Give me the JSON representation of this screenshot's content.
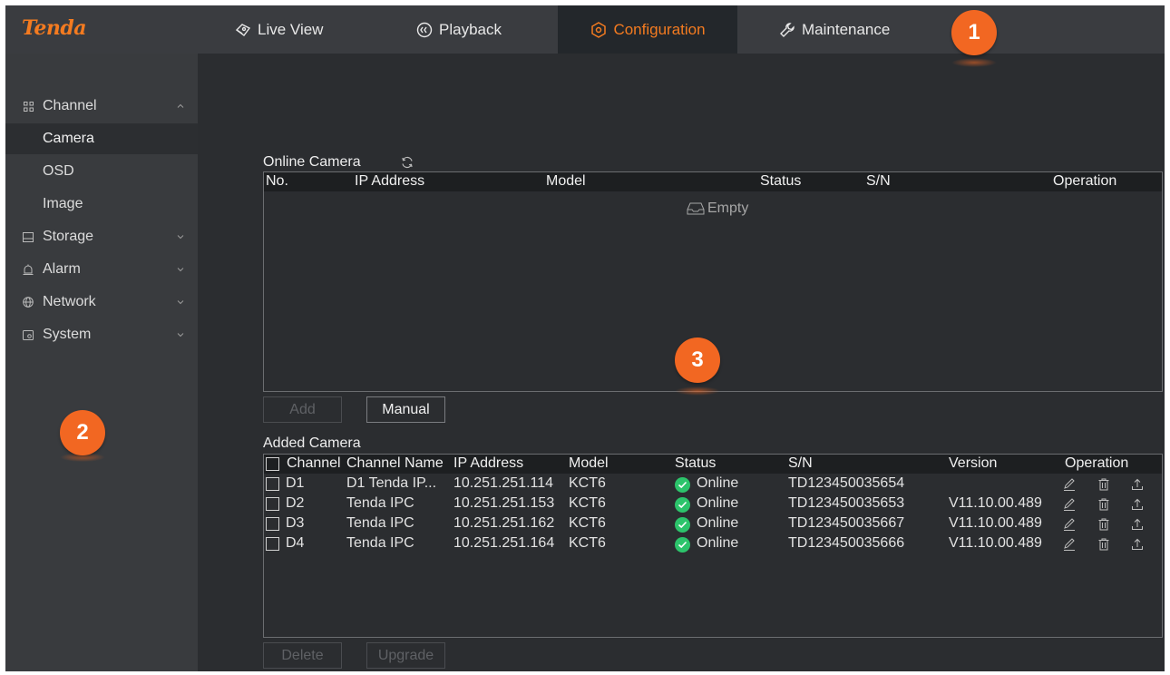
{
  "topbar": {
    "logo": "Tenda",
    "tabs": [
      {
        "label": "Live View",
        "icon": "live-view-icon"
      },
      {
        "label": "Playback",
        "icon": "playback-icon"
      },
      {
        "label": "Configuration",
        "icon": "configuration-icon",
        "active": true
      },
      {
        "label": "Maintenance",
        "icon": "wrench-icon"
      }
    ]
  },
  "sidebar": {
    "items": [
      {
        "label": "Channel",
        "icon": "grid-icon",
        "expanded": true
      },
      {
        "label": "Camera",
        "active": true
      },
      {
        "label": "OSD"
      },
      {
        "label": "Image"
      },
      {
        "label": "Storage",
        "icon": "storage-icon"
      },
      {
        "label": "Alarm",
        "icon": "alarm-icon"
      },
      {
        "label": "Network",
        "icon": "globe-icon"
      },
      {
        "label": "System",
        "icon": "system-icon"
      }
    ]
  },
  "online": {
    "title": "Online Camera",
    "columns": [
      "No.",
      "IP Address",
      "Model",
      "Status",
      "S/N",
      "Operation"
    ],
    "empty_text": "Empty",
    "add_label": "Add",
    "manual_label": "Manual"
  },
  "added": {
    "title": "Added Camera",
    "columns": [
      "Channel",
      "Channel Name",
      "IP Address",
      "Model",
      "Status",
      "S/N",
      "Version",
      "Operation"
    ],
    "rows": [
      {
        "channel": "D1",
        "name": "D1 Tenda IP...",
        "ip": "10.251.251.114",
        "model": "KCT6",
        "status": "Online",
        "sn": "TD123450035654",
        "version": ""
      },
      {
        "channel": "D2",
        "name": "Tenda IPC",
        "ip": "10.251.251.153",
        "model": "KCT6",
        "status": "Online",
        "sn": "TD123450035653",
        "version": "V11.10.00.489"
      },
      {
        "channel": "D3",
        "name": "Tenda IPC",
        "ip": "10.251.251.162",
        "model": "KCT6",
        "status": "Online",
        "sn": "TD123450035667",
        "version": "V11.10.00.489"
      },
      {
        "channel": "D4",
        "name": "Tenda IPC",
        "ip": "10.251.251.164",
        "model": "KCT6",
        "status": "Online",
        "sn": "TD123450035666",
        "version": "V11.10.00.489"
      }
    ],
    "delete_label": "Delete",
    "upgrade_label": "Upgrade"
  },
  "badges": [
    "1",
    "2",
    "3"
  ],
  "colors": {
    "accent": "#f47b20",
    "background": "#2b2d30",
    "topbar": "#3a3c40",
    "sidebar": "#393b3e",
    "online_status": "#2cc46b",
    "badge": "#f26722"
  }
}
